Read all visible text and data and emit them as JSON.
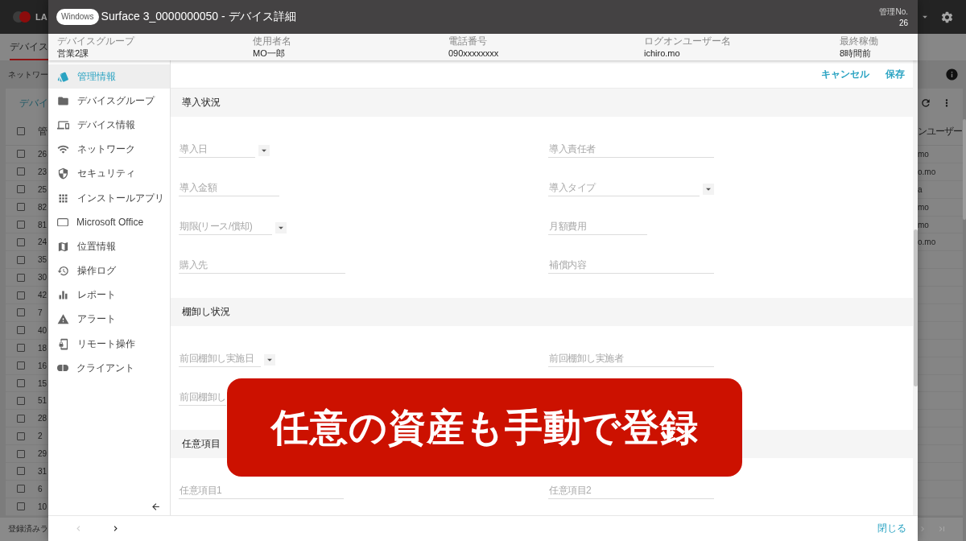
{
  "background_app": {
    "logo_text": "LA",
    "tab": {
      "label": "デバイス",
      "selected": true
    },
    "breadcrumb": "ネットワー",
    "card_title": "デバイ",
    "table": {
      "header_checked": false,
      "columns": [
        "管",
        "ンユーザー"
      ],
      "rows": [
        {
          "checked": false,
          "cells": [
            "26",
            "mo"
          ]
        },
        {
          "checked": false,
          "cells": [
            "23",
            "o.mo"
          ]
        },
        {
          "checked": false,
          "cells": [
            "25",
            "a"
          ]
        },
        {
          "checked": false,
          "cells": [
            "82",
            "mo"
          ]
        },
        {
          "checked": false,
          "cells": [
            "81",
            "mo"
          ]
        },
        {
          "checked": false,
          "cells": [
            "24",
            "o.mo"
          ]
        },
        {
          "checked": false,
          "cells": [
            "35"
          ]
        },
        {
          "checked": false,
          "cells": [
            "30"
          ]
        },
        {
          "checked": false,
          "cells": [
            "42"
          ]
        },
        {
          "checked": false,
          "cells": [
            "7"
          ]
        },
        {
          "checked": false,
          "cells": [
            "40"
          ]
        },
        {
          "checked": false,
          "cells": [
            "18"
          ]
        },
        {
          "checked": false,
          "cells": [
            "16"
          ]
        },
        {
          "checked": false,
          "cells": [
            "15"
          ]
        },
        {
          "checked": false,
          "cells": [
            "51"
          ]
        },
        {
          "checked": false,
          "cells": [
            "28"
          ]
        },
        {
          "checked": false,
          "cells": [
            "2"
          ]
        },
        {
          "checked": false,
          "cells": [
            "29"
          ]
        },
        {
          "checked": false,
          "cells": [
            "31"
          ]
        },
        {
          "checked": false,
          "cells": [
            "6"
          ]
        },
        {
          "checked": false,
          "cells": [
            "10"
          ]
        }
      ]
    },
    "footer_text": "登録済みラ"
  },
  "dialog": {
    "os_badge": "Windows",
    "title": "Surface 3_0000000050 - デバイス詳細",
    "number_label": "管理No.",
    "number": "26",
    "summary": [
      {
        "label": "デバイスグループ",
        "value": "営業2課"
      },
      {
        "label": "使用者名",
        "value": "MO一郎"
      },
      {
        "label": "電話番号",
        "value": "090xxxxxxxx"
      },
      {
        "label": "ログオンユーザー名",
        "value": "ichiro.mo"
      },
      {
        "label": "最終稼働",
        "value": "8時間前"
      }
    ],
    "nav": [
      {
        "label": "管理情報",
        "selected": true
      },
      {
        "label": "デバイスグループ",
        "selected": false
      },
      {
        "label": "デバイス情報",
        "selected": false
      },
      {
        "label": "ネットワーク",
        "selected": false
      },
      {
        "label": "セキュリティ",
        "selected": false
      },
      {
        "label": "インストールアプリ",
        "selected": false
      },
      {
        "label": "Microsoft Office",
        "selected": false
      },
      {
        "label": "位置情報",
        "selected": false
      },
      {
        "label": "操作ログ",
        "selected": false
      },
      {
        "label": "レポート",
        "selected": false
      },
      {
        "label": "アラート",
        "selected": false
      },
      {
        "label": "リモート操作",
        "selected": false
      },
      {
        "label": "クライアント",
        "selected": false
      }
    ],
    "actions": [
      {
        "label": "キャンセル"
      },
      {
        "label": "保存"
      }
    ],
    "sections": [
      {
        "title": "導入状況",
        "fields": [
          {
            "placeholder": "導入日",
            "kind": "dropdown"
          },
          {
            "placeholder": "導入責任者",
            "kind": "text"
          },
          {
            "placeholder": "導入金額",
            "kind": "text"
          },
          {
            "placeholder": "導入タイプ",
            "kind": "dropdown"
          },
          {
            "placeholder": "期限(リース/償却)",
            "kind": "dropdown"
          },
          {
            "placeholder": "月額費用",
            "kind": "text"
          },
          {
            "placeholder": "購入先",
            "kind": "text"
          },
          {
            "placeholder": "補償内容",
            "kind": "text"
          }
        ]
      },
      {
        "title": "棚卸し状況",
        "fields": [
          {
            "placeholder": "前回棚卸し実施日",
            "kind": "dropdown"
          },
          {
            "placeholder": "前回棚卸し実施者",
            "kind": "text"
          },
          {
            "placeholder": "前回棚卸し",
            "kind": "text"
          }
        ]
      },
      {
        "title": "任意項目",
        "fields": [
          {
            "placeholder": "任意項目1",
            "kind": "text"
          },
          {
            "placeholder": "任意項目2",
            "kind": "text"
          }
        ]
      }
    ],
    "pager": {
      "previous_disabled": true,
      "next_disabled": false
    },
    "close": "閉じる"
  },
  "caption": "任意の資産も手動で登録"
}
